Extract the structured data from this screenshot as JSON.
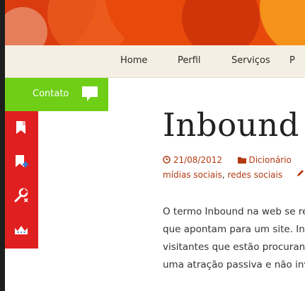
{
  "nav": {
    "items": [
      {
        "label": "Home"
      },
      {
        "label": "Perfil"
      },
      {
        "label": "Serviços"
      },
      {
        "label": "P"
      }
    ]
  },
  "sidebar": {
    "contact_label": "Contato",
    "contact_icon": "speech-bubble-icon",
    "buttons": [
      {
        "icon": "bookmark-icon"
      },
      {
        "icon": "add-bookmark-icon"
      },
      {
        "icon": "wrench-remove-icon"
      },
      {
        "icon": "crown-icon"
      }
    ],
    "colors": {
      "contact_bg": "#6fcf17",
      "buttons_bg": "#e02020"
    }
  },
  "post": {
    "title": "Inbound",
    "date": "21/08/2012",
    "category": "Dicionário",
    "tags": [
      "mídias sociais",
      "redes sociais"
    ],
    "tag_separator": ",",
    "body_lines": [
      "O termo Inbound na web se re",
      "que apontam para um site. Inb",
      "visitantes que estão procuran",
      "uma atração passiva e não inv"
    ]
  },
  "colors": {
    "banner": "#e84a0c",
    "navbar_bg": "#f4efe2",
    "link": "#b23a12"
  }
}
